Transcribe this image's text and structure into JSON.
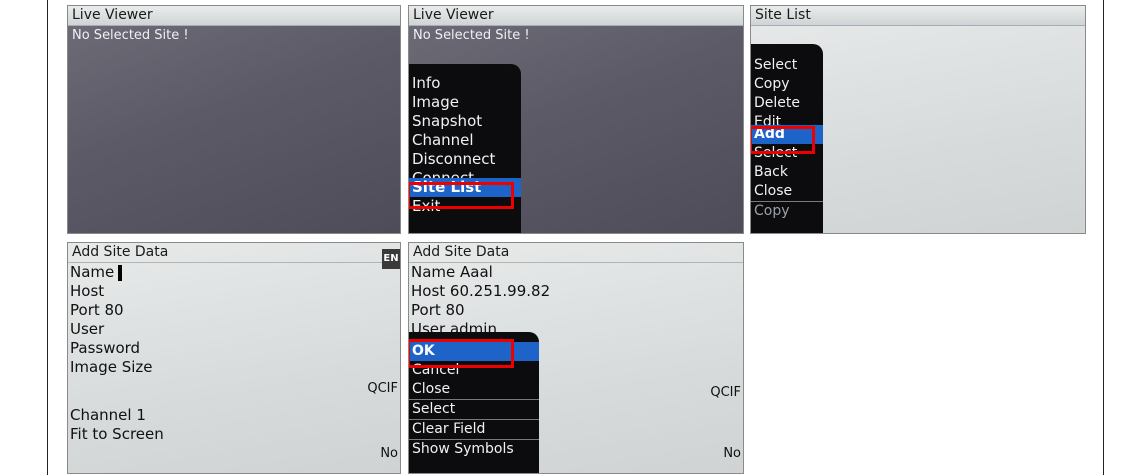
{
  "panel1": {
    "title": "Live Viewer",
    "notice": "No Selected Site !"
  },
  "panel2": {
    "title": "Live Viewer",
    "notice": "No Selected Site !",
    "menu": [
      "Info",
      "Image",
      "Snapshot",
      "Channel",
      "Disconnect",
      "Connect",
      "Site List",
      "Exit"
    ]
  },
  "panel3": {
    "title": "Site List",
    "menu": [
      "Select",
      "Copy",
      "Delete",
      "Edit",
      "Add",
      "Select",
      "Back",
      "Close",
      "Copy"
    ]
  },
  "panel4": {
    "title": "Add Site Data",
    "lang_badge": "EN",
    "fields": {
      "name": "Name",
      "host": "Host",
      "port": "Port 80",
      "user": "User",
      "password": "Password",
      "image_size": "Image Size",
      "image_size_value": "QCIF",
      "channel": "Channel 1",
      "fit": "Fit to Screen",
      "fit_value": "No"
    }
  },
  "panel5": {
    "title": "Add Site Data",
    "fields": {
      "name": "Name Aaal",
      "host": "Host 60.251.99.82",
      "port": "Port 80",
      "user": "User admin",
      "image_size_value": "QCIF",
      "fit_value": "No"
    },
    "menu": [
      "OK",
      "Cancel",
      "Close",
      "Select",
      "Clear Field",
      "Show Symbols"
    ]
  }
}
